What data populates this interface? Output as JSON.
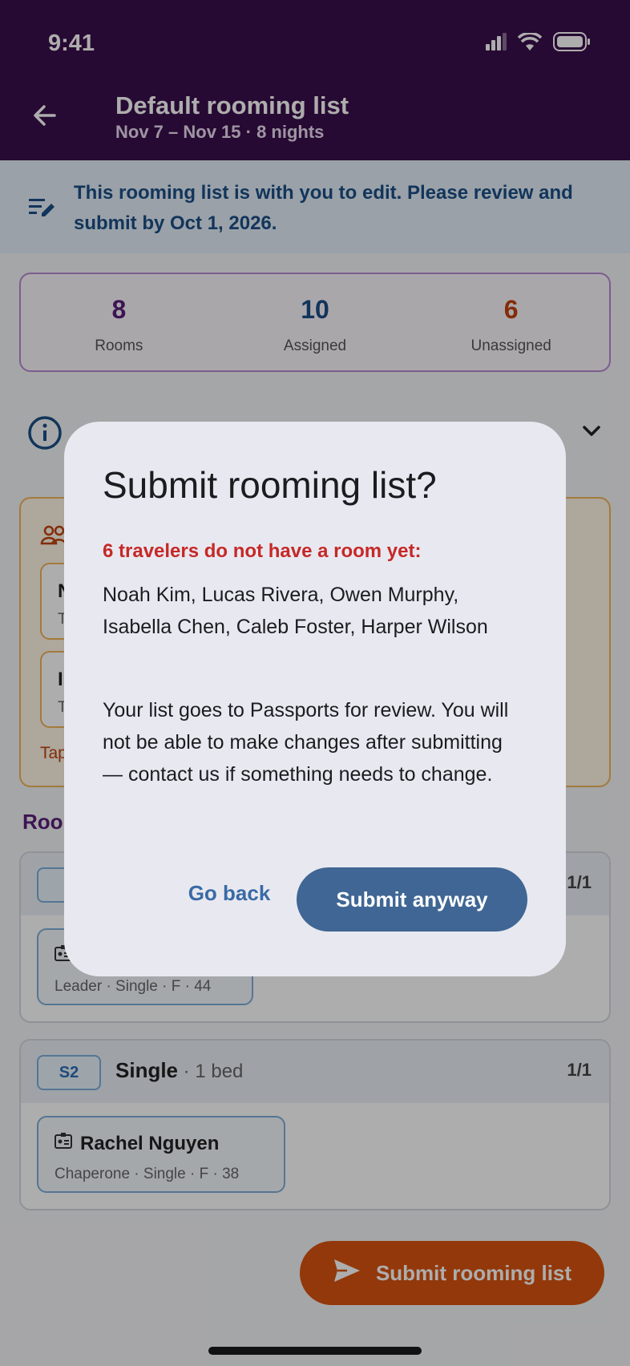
{
  "status_bar": {
    "time": "9:41"
  },
  "header": {
    "title": "Default rooming list",
    "subtitle": "Nov 7 – Nov 15 · 8 nights"
  },
  "banner": {
    "text": "This rooming list is with you to edit. Please review and submit by Oct 1, 2026."
  },
  "stats": [
    {
      "value": "8",
      "label": "Rooms",
      "color": "#5a1f7a"
    },
    {
      "value": "10",
      "label": "Assigned",
      "color": "#1b4e86"
    },
    {
      "value": "6",
      "label": "Unassigned",
      "color": "#c2410c"
    }
  ],
  "unassigned": {
    "chips": [
      {
        "initial": "N",
        "meta_initial": "T"
      },
      {
        "initial": "I",
        "meta_initial": "T"
      }
    ],
    "hint": "Tap"
  },
  "rooms_section": {
    "title": "Roo"
  },
  "rooms": [
    {
      "badge": "S",
      "count": "1/1",
      "person_meta": "Leader · Single · F · 44"
    },
    {
      "badge": "S2",
      "type": "Single",
      "beds": " · 1 bed",
      "count": "1/1",
      "person_name": "Rachel Nguyen",
      "person_meta": "Chaperone · Single · F · 38"
    }
  ],
  "submit_fab": {
    "label": "Submit rooming list"
  },
  "dialog": {
    "title": "Submit rooming list?",
    "warning": "6 travelers do not have a room yet:",
    "names": "Noah Kim, Lucas Rivera, Owen Murphy, Isabella Chen, Caleb Foster, Harper Wilson",
    "body": "Your list goes to Passports for review. You will not be able to make changes after submitting — contact us if something needs to change.",
    "back_label": "Go back",
    "submit_label": "Submit anyway"
  }
}
